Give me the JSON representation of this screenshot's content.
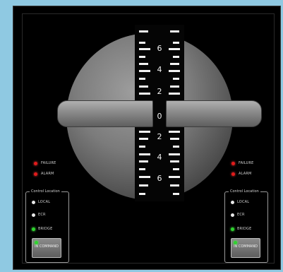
{
  "scale": {
    "top_labels": [
      "6",
      "4",
      "2"
    ],
    "center_label": "0",
    "bottom_labels": [
      "2",
      "4",
      "6"
    ]
  },
  "left": {
    "failure_label": "FAILURE",
    "alarm_label": "ALARM",
    "control_location_title": "Control Location",
    "local_label": "LOCAL",
    "ecr_label": "ECR",
    "bridge_label": "BRIDGE",
    "command_button_label": "IN COMMAND"
  },
  "right": {
    "failure_label": "FAILURE",
    "alarm_label": "ALARM",
    "control_location_title": "Control Location",
    "local_label": "LOCAL",
    "ecr_label": "ECR",
    "bridge_label": "BRIDGE",
    "command_button_label": "IN COMMAND"
  },
  "colors": {
    "alarm_led": "#e21b1b",
    "active_led": "#2ed32e",
    "inactive_led": "#e8e8e8"
  }
}
